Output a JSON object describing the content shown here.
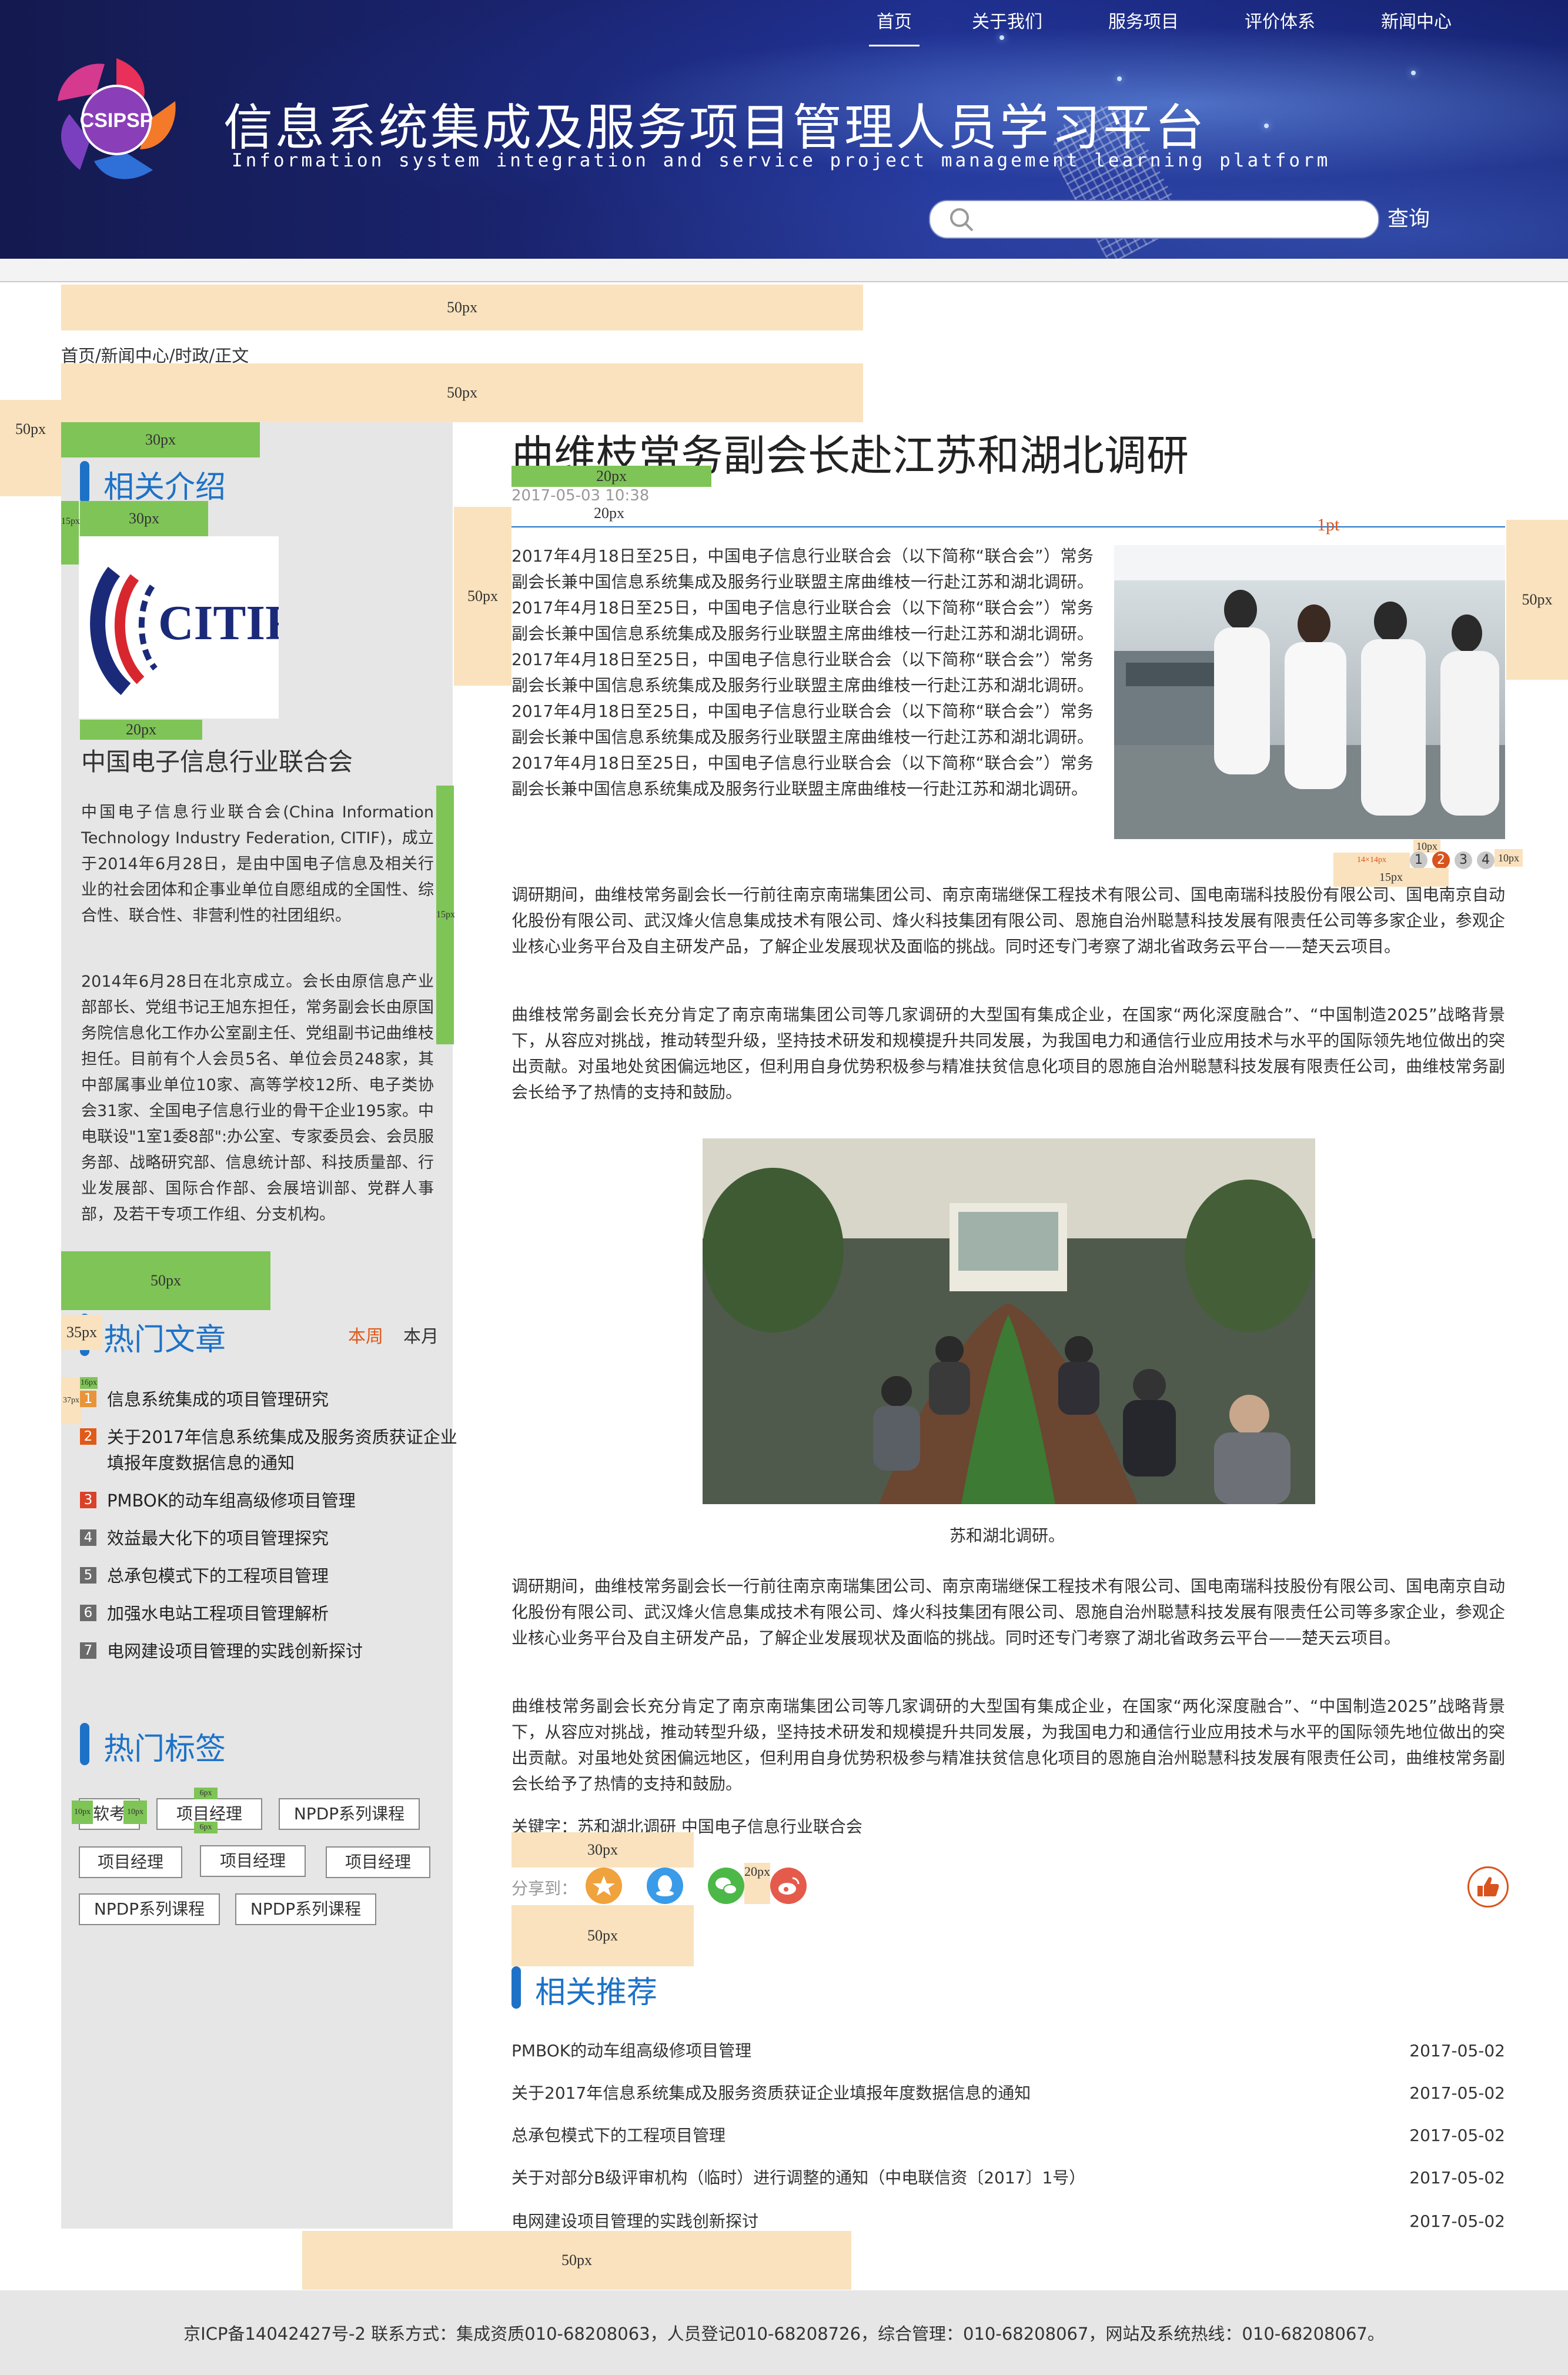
{
  "header": {
    "logo_text": "CSIPSP",
    "title": "信息系统集成及服务项目管理人员学习平台",
    "subtitle": "Information system integration and service project management learning platform",
    "nav": [
      "首页",
      "关于我们",
      "服务项目",
      "评价体系",
      "新闻中心"
    ],
    "nav_active": "首页",
    "search_placeholder": "",
    "search_button": "查询"
  },
  "annotations": {
    "a50": "50px",
    "a30": "30px",
    "a20": "20px",
    "a15": "15px",
    "a10": "10px",
    "a35": "35px",
    "a16": "16px",
    "a37": "37px",
    "a1pt": "1pt",
    "a14x14": "14×14px",
    "a6": "6px"
  },
  "breadcrumb": "首页/新闻中心/时政/正文",
  "sidebar": {
    "intro_title": "相关介绍",
    "org_logo_text": "CITIF",
    "org_name": "中国电子信息行业联合会",
    "org_para1": "中国电子信息行业联合会(China Information Technology Industry Federation, CITIF)，成立于2014年6月28日，是由中国电子信息及相关行业的社会团体和企事业单位自愿组成的全国性、综合性、联合性、非营利性的社团组织。",
    "org_para2": "2014年6月28日在北京成立。会长由原信息产业部部长、党组书记王旭东担任，常务副会长由原国务院信息化工作办公室副主任、党组副书记曲维枝担任。目前有个人会员5名、单位会员248家，其中部属事业单位10家、高等学校12所、电子类协会31家、全国电子信息行业的骨干企业195家。中电联设\"1室1委8部\":办公室、专家委员会、会员服务部、战略研究部、信息统计部、科技质量部、行业发展部、国际合作部、会展培训部、党群人事部，及若干专项工作组、分支机构。",
    "hot_title": "热门文章",
    "hot_tabs": [
      "本周",
      "本月"
    ],
    "hot_articles": [
      "信息系统集成的项目管理研究",
      "关于2017年信息系统集成及服务资质获证企业填报年度数据信息的通知",
      "PMBOK的动车组高级修项目管理",
      "效益最大化下的项目管理探究",
      "总承包模式下的工程项目管理",
      "加强水电站工程项目管理解析",
      "电网建设项目管理的实践创新探讨"
    ],
    "tags_title": "热门标签",
    "tags": [
      "软考",
      "项目经理",
      "NPDP系列课程",
      "项目经理",
      "项目经理",
      "项目经理",
      "NPDP系列课程",
      "NPDP系列课程"
    ]
  },
  "article": {
    "title": "曲维枝常务副会长赴江苏和湖北调研",
    "date": "2017-05-03 10:38",
    "para1": "2017年4月18日至25日，中国电子信息行业联合会（以下简称“联合会”）常务副会长兼中国信息系统集成及服务行业联盟主席曲维枝一行赴江苏和湖北调研。2017年4月18日至25日，中国电子信息行业联合会（以下简称“联合会”）常务副会长兼中国信息系统集成及服务行业联盟主席曲维枝一行赴江苏和湖北调研。2017年4月18日至25日，中国电子信息行业联合会（以下简称“联合会”）常务副会长兼中国信息系统集成及服务行业联盟主席曲维枝一行赴江苏和湖北调研。2017年4月18日至25日，中国电子信息行业联合会（以下简称“联合会”）常务副会长兼中国信息系统集成及服务行业联盟主席曲维枝一行赴江苏和湖北调研。2017年4月18日至25日，中国电子信息行业联合会（以下简称“联合会”）常务副会长兼中国信息系统集成及服务行业联盟主席曲维枝一行赴江苏和湖北调研。",
    "carousel": [
      "1",
      "2",
      "3",
      "4"
    ],
    "carousel_active": "2",
    "para2": "调研期间，曲维枝常务副会长一行前往南京南瑞集团公司、南京南瑞继保工程技术有限公司、国电南瑞科技股份有限公司、国电南京自动化股份有限公司、武汉烽火信息集成技术有限公司、烽火科技集团有限公司、恩施自治州聪慧科技发展有限责任公司等多家企业，参观企业核心业务平台及自主研发产品，了解企业发展现状及面临的挑战。同时还专门考察了湖北省政务云平台——楚天云项目。",
    "para3": "曲维枝常务副会长充分肯定了南京南瑞集团公司等几家调研的大型国有集成企业，在国家“两化深度融合”、“中国制造2025”战略背景下，从容应对挑战，推动转型升级，坚持技术研发和规模提升共同发展，为我国电力和通信行业应用技术与水平的国际领先地位做出的突出贡献。对虽地处贫困偏远地区，但利用自身优势积极参与精准扶贫信息化项目的恩施自治州聪慧科技发展有限责任公司，曲维枝常务副会长给予了热情的支持和鼓励。",
    "photo2_caption": "苏和湖北调研。",
    "para4": "调研期间，曲维枝常务副会长一行前往南京南瑞集团公司、南京南瑞继保工程技术有限公司、国电南瑞科技股份有限公司、国电南京自动化股份有限公司、武汉烽火信息集成技术有限公司、烽火科技集团有限公司、恩施自治州聪慧科技发展有限责任公司等多家企业，参观企业核心业务平台及自主研发产品，了解企业发展现状及面临的挑战。同时还专门考察了湖北省政务云平台——楚天云项目。",
    "para5": "曲维枝常务副会长充分肯定了南京南瑞集团公司等几家调研的大型国有集成企业，在国家“两化深度融合”、“中国制造2025”战略背景下，从容应对挑战，推动转型升级，坚持技术研发和规模提升共同发展，为我国电力和通信行业应用技术与水平的国际领先地位做出的突出贡献。对虽地处贫困偏远地区，但利用自身优势积极参与精准扶贫信息化项目的恩施自治州聪慧科技发展有限责任公司，曲维枝常务副会长给予了热情的支持和鼓励。",
    "keywords": "关键字：苏和湖北调研  中国电子信息行业联合会",
    "share_label": "分享到：",
    "share_icons": [
      "qzone-icon",
      "qq-icon",
      "wechat-icon",
      "weibo-icon"
    ],
    "related_title": "相关推荐",
    "related": [
      {
        "title": "PMBOK的动车组高级修项目管理",
        "date": "2017-05-02"
      },
      {
        "title": "关于2017年信息系统集成及服务资质获证企业填报年度数据信息的通知",
        "date": "2017-05-02"
      },
      {
        "title": "总承包模式下的工程项目管理",
        "date": "2017-05-02"
      },
      {
        "title": "关于对部分B级评审机构（临时）进行调整的通知（中电联信资〔2017〕1号）",
        "date": "2017-05-02"
      },
      {
        "title": "电网建设项目管理的实践创新探讨",
        "date": "2017-05-02"
      }
    ]
  },
  "footer": {
    "text": "京ICP备14042427号-2  联系方式：集成资质010-68208063，人员登记010-68208726，综合管理：010-68208067，网站及系统热线：010-68208067。"
  },
  "colors": {
    "accent": "#1d72c7",
    "rank_top": "#e05a1a",
    "rank_other": "#555555",
    "annotation": "#f9e2bd",
    "annotation_green": "#7fc457"
  }
}
